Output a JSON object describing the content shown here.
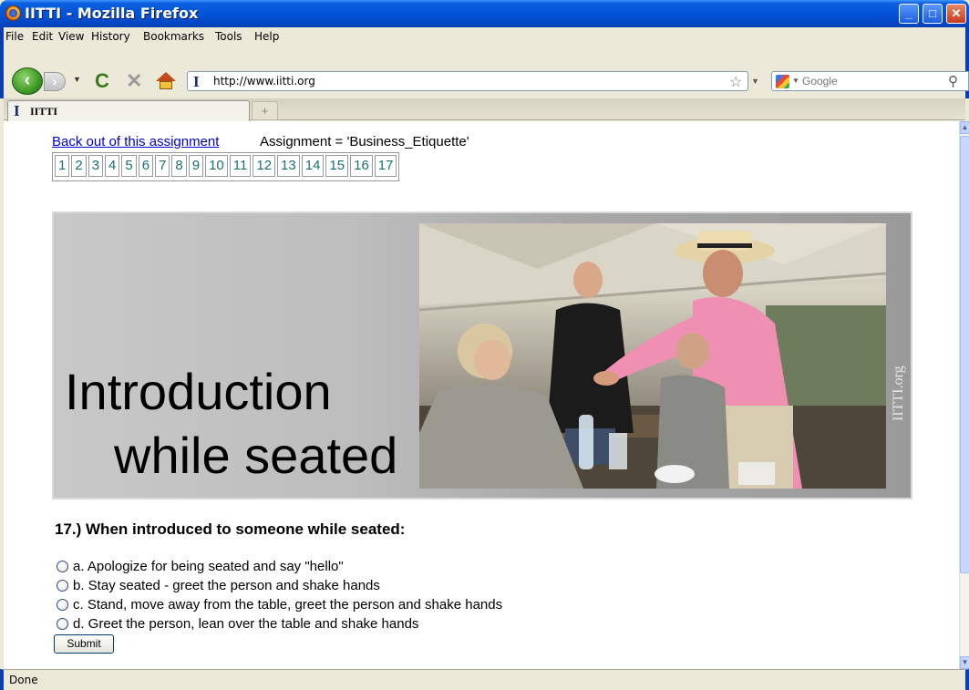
{
  "window": {
    "title": "IITTI - Mozilla Firefox"
  },
  "menu": [
    "File",
    "Edit",
    "View",
    "History",
    "Bookmarks",
    "Tools",
    "Help"
  ],
  "navbar": {
    "url": "http://www.iitti.org",
    "search_placeholder": "Google"
  },
  "tab": {
    "label": "IITTI",
    "new_tab_symbol": "+"
  },
  "page": {
    "back_link": "Back out of this assignment",
    "assignment": "Assignment = 'Business_Etiquette'",
    "question_numbers": [
      "1",
      "2",
      "3",
      "4",
      "5",
      "6",
      "7",
      "8",
      "9",
      "10",
      "11",
      "12",
      "13",
      "14",
      "15",
      "16",
      "17"
    ],
    "banner": {
      "line1": "Introduction",
      "line2": "while seated",
      "watermark": "IITTI.org"
    },
    "question": "17.) When introduced to someone while seated:",
    "options": [
      "a. Apologize for being seated and say \"hello\"",
      "b. Stay seated - greet the person and shake hands",
      "c. Stand, move away from the table, greet the person and shake hands",
      "d. Greet the person, lean over the table and shake hands"
    ],
    "submit_label": "Submit"
  },
  "status": {
    "text": "Done"
  }
}
